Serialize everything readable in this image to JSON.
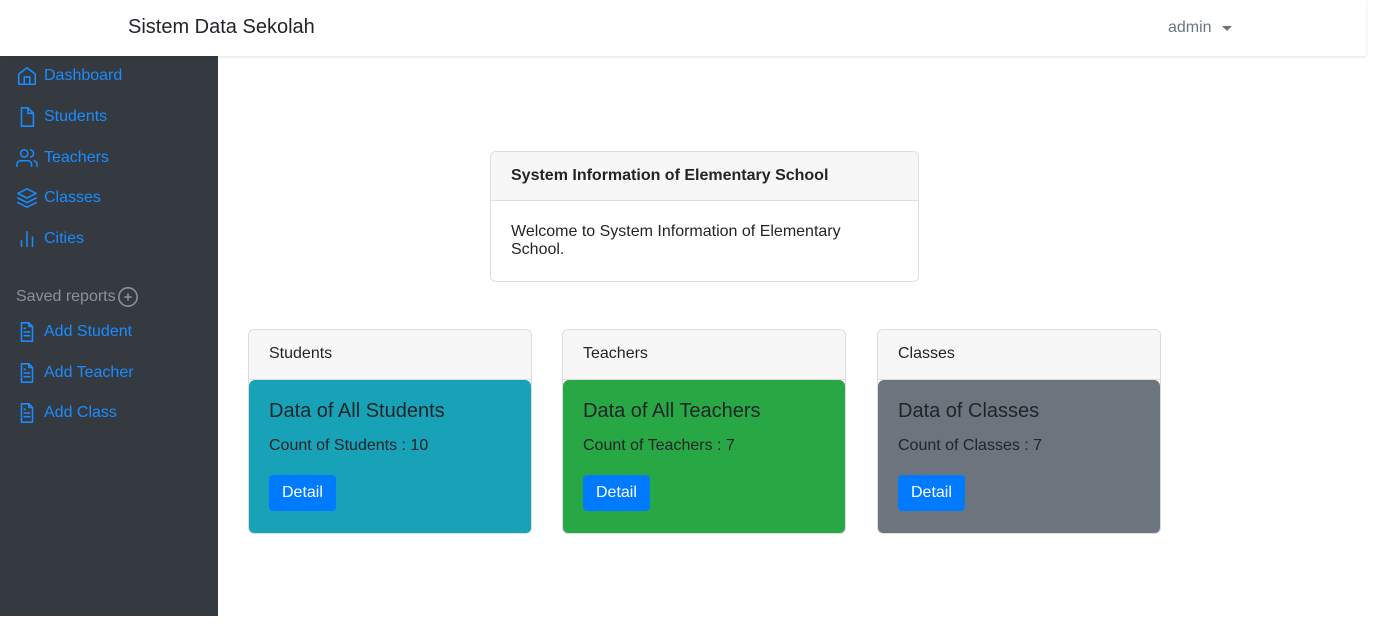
{
  "navbar": {
    "brand": "Sistem Data Sekolah",
    "user": "admin"
  },
  "sidebar": {
    "items": [
      {
        "label": "Dashboard",
        "icon": "home-icon"
      },
      {
        "label": "Students",
        "icon": "file-icon"
      },
      {
        "label": "Teachers",
        "icon": "users-icon"
      },
      {
        "label": "Classes",
        "icon": "layers-icon"
      },
      {
        "label": "Cities",
        "icon": "bar-chart-icon"
      }
    ],
    "reports_heading": "Saved reports",
    "reports": [
      {
        "label": "Add Student",
        "icon": "file-text-icon"
      },
      {
        "label": "Add Teacher",
        "icon": "file-text-icon"
      },
      {
        "label": "Add Class",
        "icon": "file-text-icon"
      }
    ]
  },
  "info": {
    "title": "System Information of Elementary School",
    "body": "Welcome to System Information of Elementary School."
  },
  "cards": [
    {
      "header": "Students",
      "title": "Data of All Students",
      "count": "Count of Students : 10",
      "button": "Detail",
      "color": "#17a2b8"
    },
    {
      "header": "Teachers",
      "title": "Data of All Teachers",
      "count": "Count of Teachers : 7",
      "button": "Detail",
      "color": "#28a745"
    },
    {
      "header": "Classes",
      "title": "Data of Classes",
      "count": "Count of Classes : 7",
      "button": "Detail",
      "color": "#6c757d"
    }
  ]
}
